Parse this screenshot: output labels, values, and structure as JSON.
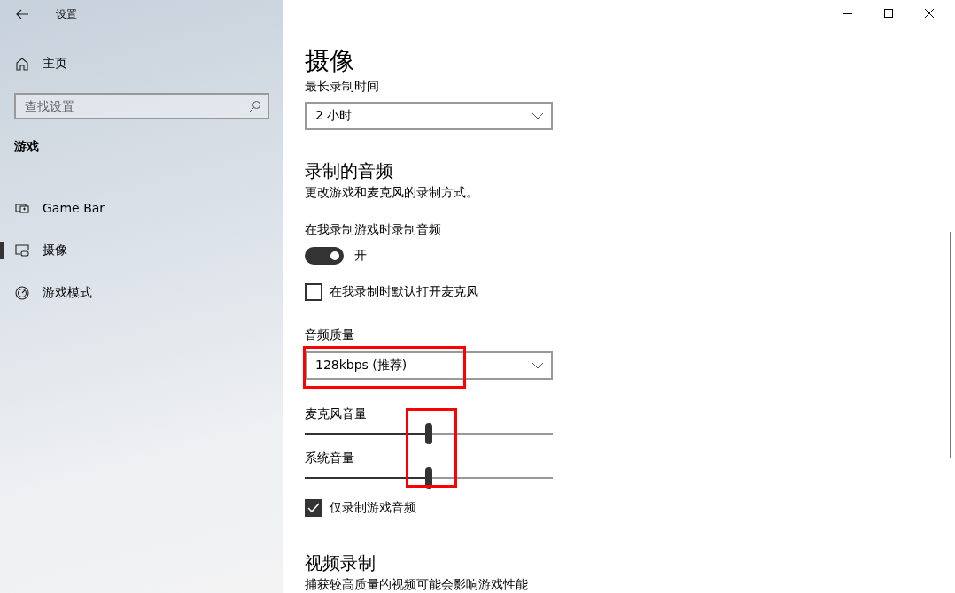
{
  "window": {
    "title": "设置"
  },
  "sidebar": {
    "home": "主页",
    "search": {
      "placeholder": "查找设置"
    },
    "section": "游戏",
    "items": [
      {
        "label": "Game Bar",
        "kind": "gamebar",
        "selected": false
      },
      {
        "label": "摄像",
        "kind": "capture",
        "selected": true
      },
      {
        "label": "游戏模式",
        "kind": "gamemode",
        "selected": false
      }
    ]
  },
  "page": {
    "title": "摄像",
    "max_length": {
      "label": "最长录制时间",
      "value": "2 小时"
    },
    "audio": {
      "heading": "录制的音频",
      "description": "更改游戏和麦克风的录制方式。",
      "record_toggle": {
        "label": "在我录制游戏时录制音频",
        "on": true,
        "state_text": "开"
      },
      "mic_default": {
        "label": "在我录制时默认打开麦克风",
        "checked": false
      },
      "quality": {
        "label": "音频质量",
        "value": "128kbps (推荐)",
        "highlighted": true
      },
      "sliders_highlighted": true,
      "sliders": [
        {
          "label": "麦克风音量",
          "level": 0.5
        },
        {
          "label": "系统音量",
          "level": 0.5
        }
      ],
      "game_only": {
        "label": "仅录制游戏音频",
        "checked": true
      }
    },
    "video": {
      "heading": "视频录制",
      "description": "捕获较高质量的视频可能会影响游戏性能"
    }
  }
}
